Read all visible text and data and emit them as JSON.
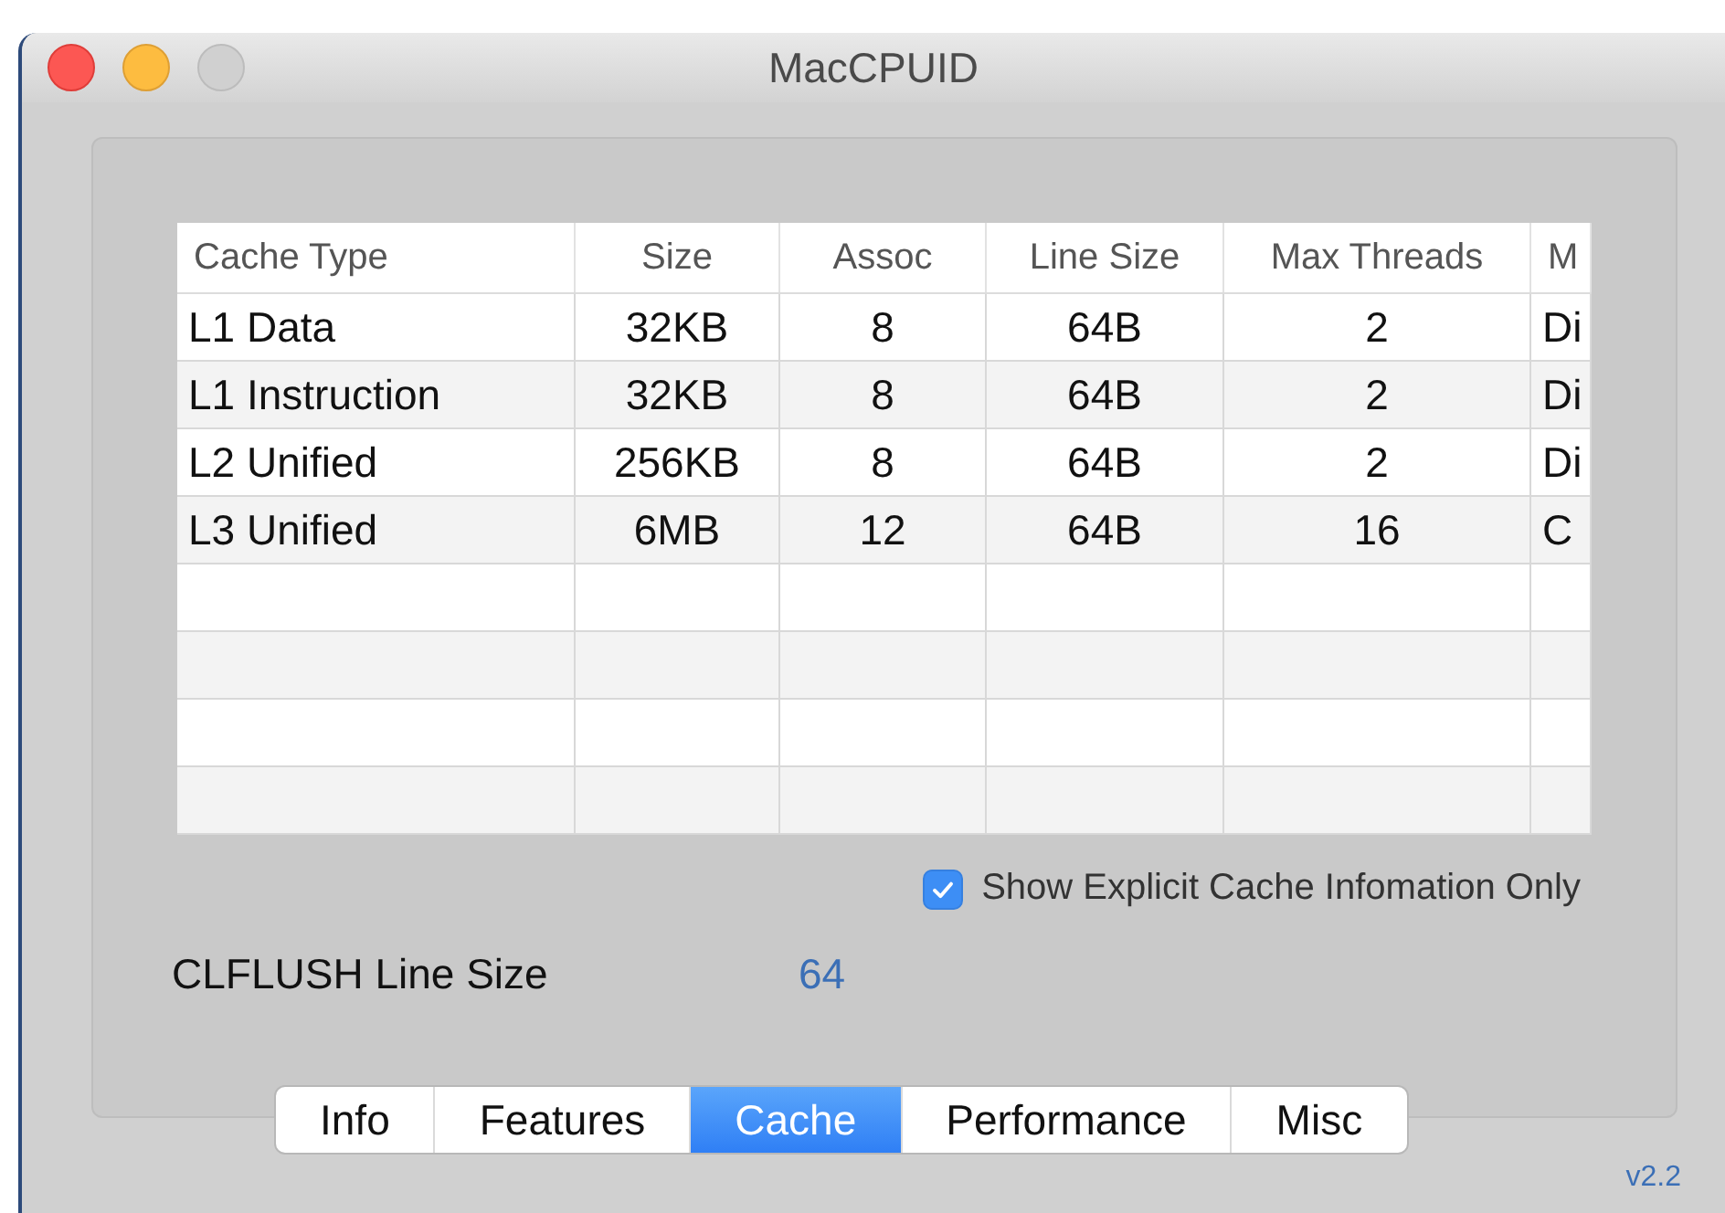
{
  "window": {
    "title": "MacCPUID"
  },
  "table": {
    "columns": [
      "Cache Type",
      "Size",
      "Assoc",
      "Line Size",
      "Max Threads",
      "M"
    ],
    "rows": [
      [
        "L1 Data",
        "32KB",
        "8",
        "64B",
        "2",
        "Di"
      ],
      [
        "L1 Instruction",
        "32KB",
        "8",
        "64B",
        "2",
        "Di"
      ],
      [
        "L2 Unified",
        "256KB",
        "8",
        "64B",
        "2",
        "Di"
      ],
      [
        "L3 Unified",
        "6MB",
        "12",
        "64B",
        "16",
        "C"
      ]
    ]
  },
  "explicit_only": {
    "label": "Show Explicit Cache Infomation Only",
    "checked": true
  },
  "clflush": {
    "label": "CLFLUSH Line Size",
    "value": "64"
  },
  "tabs": [
    {
      "label": "Info",
      "selected": false
    },
    {
      "label": "Features",
      "selected": false
    },
    {
      "label": "Cache",
      "selected": true
    },
    {
      "label": "Performance",
      "selected": false
    },
    {
      "label": "Misc",
      "selected": false
    }
  ],
  "version": "v2.2"
}
